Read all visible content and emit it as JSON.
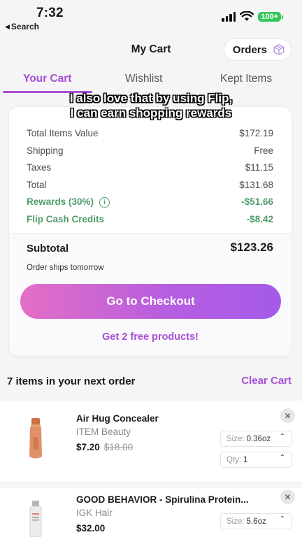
{
  "status_bar": {
    "time": "7:32",
    "back_label": "Search",
    "battery": "100+",
    "icons": [
      "signal-icon",
      "wifi-icon",
      "battery-icon"
    ]
  },
  "header": {
    "title": "My Cart",
    "orders_label": "Orders"
  },
  "tabs": [
    {
      "label": "Your Cart",
      "active": true
    },
    {
      "label": "Wishlist",
      "active": false
    },
    {
      "label": "Kept Items",
      "active": false
    }
  ],
  "caption": {
    "line1": "I also love that by using Flip,",
    "line2": "I can earn shopping rewards"
  },
  "summary": {
    "rows": [
      {
        "label": "Total Items Value",
        "value": "$172.19"
      },
      {
        "label": "Shipping",
        "value": "Free"
      },
      {
        "label": "Taxes",
        "value": "$11.15"
      },
      {
        "label": "Total",
        "value": "$131.68"
      },
      {
        "label": "Rewards (30%)",
        "value": "-$51.66"
      },
      {
        "label": "Flip Cash Credits",
        "value": "-$8.42"
      }
    ],
    "subtotal_label": "Subtotal",
    "subtotal_value": "$123.26",
    "ships_note": "Order ships tomorrow",
    "checkout_label": "Go to Checkout",
    "free_products_label": "Get 2 free products!"
  },
  "next_order": {
    "title": "7 items in your next order",
    "clear_label": "Clear Cart"
  },
  "items": [
    {
      "name": "Air Hug Concealer",
      "brand": "ITEM Beauty",
      "price": "$7.20",
      "original_price": "$18.00",
      "size_label": "Size:",
      "size_value": "0.36oz",
      "qty_label": "Qty:",
      "qty_value": "1"
    },
    {
      "name": "GOOD BEHAVIOR - Spirulina Protein...",
      "brand": "IGK Hair",
      "price": "$32.00",
      "size_label": "Size:",
      "size_value": "5.6oz"
    }
  ],
  "colors": {
    "accent": "#a84ed8",
    "reward_green": "#4f9d6b",
    "checkout_gradient_start": "#e36fc4",
    "checkout_gradient_end": "#a45ae8",
    "battery": "#34c759"
  }
}
